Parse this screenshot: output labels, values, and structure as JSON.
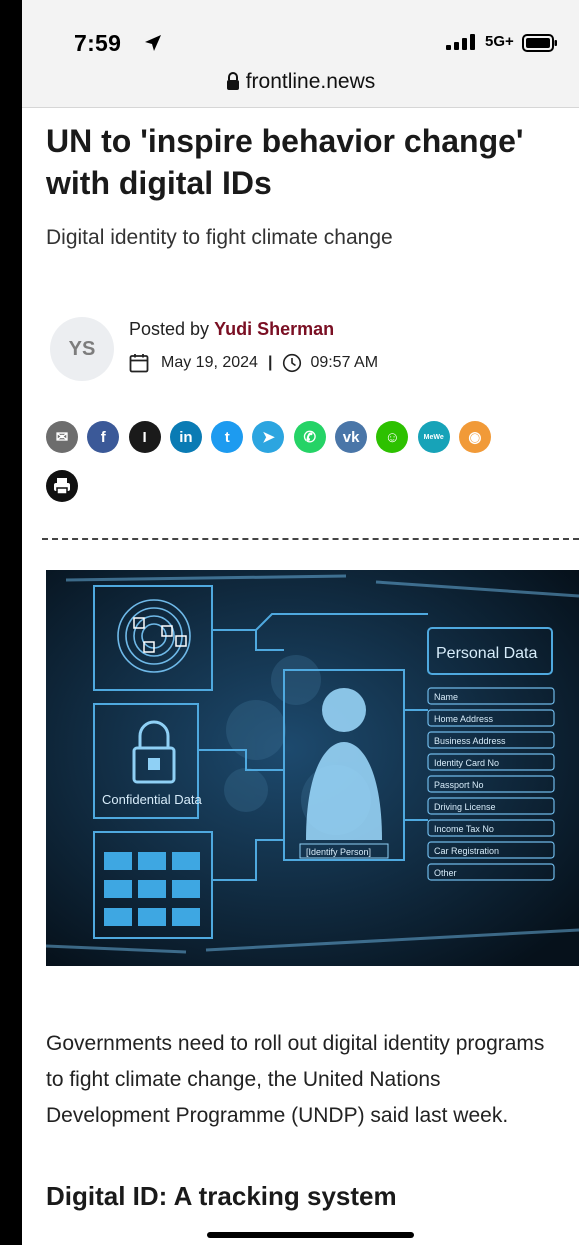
{
  "status_bar": {
    "time": "7:59",
    "network": "5G+"
  },
  "browser": {
    "url": "frontline.news"
  },
  "article": {
    "title": "UN to 'inspire behavior change' with digital IDs",
    "subtitle": "Digital identity to fight climate change",
    "avatar_initials": "YS",
    "posted_by_label": "Posted by",
    "author": "Yudi Sherman",
    "date": "May 19, 2024",
    "separator": "|",
    "time": "09:57 AM",
    "body": "Governments need to roll out digital identity programs to fight climate change, the United Nations Development Programme (UNDP) said last week.",
    "section_heading": "Digital ID: A tracking system"
  },
  "share_buttons": [
    {
      "name": "email-icon",
      "glyph": "✉",
      "color": "#6d6d6d"
    },
    {
      "name": "facebook-icon",
      "glyph": "f",
      "color": "#3b5998"
    },
    {
      "name": "instapaper-icon",
      "glyph": "I",
      "color": "#1a1a1a"
    },
    {
      "name": "linkedin-icon",
      "glyph": "in",
      "color": "#0a7bb4"
    },
    {
      "name": "twitter-icon",
      "glyph": "t",
      "color": "#1d9bf0"
    },
    {
      "name": "telegram-icon",
      "glyph": "➤",
      "color": "#2ca5e0"
    },
    {
      "name": "whatsapp-icon",
      "glyph": "✆",
      "color": "#25d366"
    },
    {
      "name": "vk-icon",
      "glyph": "vk",
      "color": "#4a76a8"
    },
    {
      "name": "wechat-icon",
      "glyph": "☺",
      "color": "#2dc100"
    },
    {
      "name": "mewe-icon",
      "glyph": "MeWe",
      "color": "#17a3b8"
    },
    {
      "name": "rss-icon",
      "glyph": "◉",
      "color": "#f19a38"
    }
  ],
  "hero_image": {
    "personal_data_title": "Personal Data",
    "confidential_label": "Confidential Data",
    "identify_label": "[Identify Person]",
    "fields": [
      "Name",
      "Home Address",
      "Business Address",
      "Identity Card No",
      "Passport No",
      "Driving License",
      "Income Tax No",
      "Car Registration",
      "Other"
    ]
  }
}
